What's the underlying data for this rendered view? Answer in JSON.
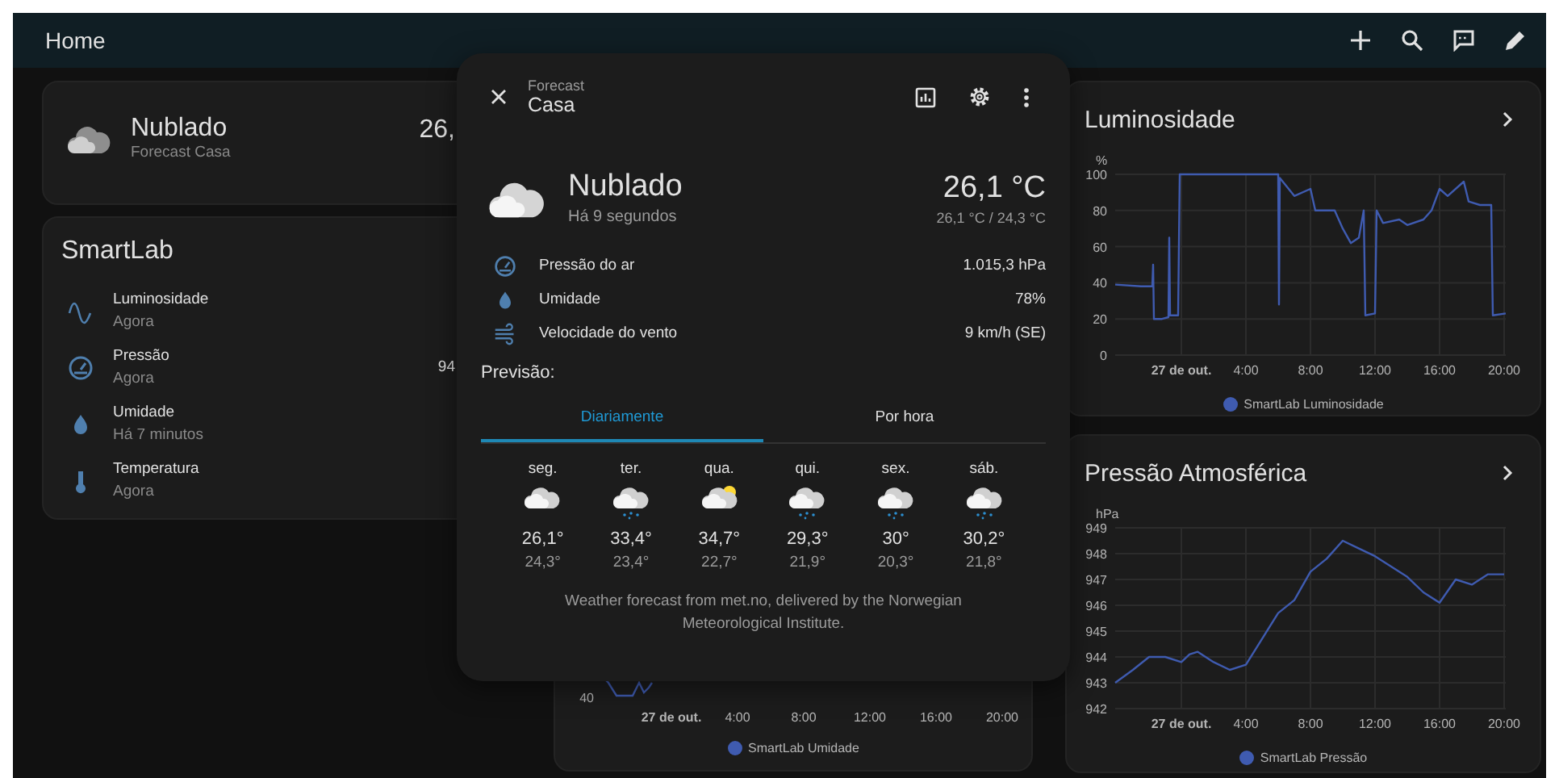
{
  "header": {
    "title": "Home"
  },
  "weather_card": {
    "condition": "Nublado",
    "name": "Forecast Casa",
    "temperature": "26,"
  },
  "smartlab": {
    "title": "SmartLab",
    "entities": [
      {
        "kind": "wave",
        "name": "Luminosidade",
        "time": "Agora"
      },
      {
        "kind": "gauge",
        "name": "Pressão",
        "time": "Agora",
        "value": "94"
      },
      {
        "kind": "drop",
        "name": "Umidade",
        "time": "Há 7 minutos"
      },
      {
        "kind": "thermometer",
        "name": "Temperatura",
        "time": "Agora"
      }
    ]
  },
  "humidity_card": {
    "ytick": "40",
    "xlabels": [
      "27 de out.",
      "4:00",
      "8:00",
      "12:00",
      "16:00",
      "20:00"
    ],
    "legend": "SmartLab Umidade"
  },
  "luminosity_card": {
    "title": "Luminosidade",
    "date_label": "27 de out.",
    "chart_data": {
      "type": "line",
      "grid": true,
      "ylabel": "%",
      "xlim": [
        -4.1,
        20.1
      ],
      "ylim": [
        0,
        100
      ],
      "yticks": [
        0,
        20,
        40,
        60,
        80,
        100
      ],
      "xticks": [
        {
          "value": 4,
          "label": "4:00"
        },
        {
          "value": 8,
          "label": "8:00"
        },
        {
          "value": 12,
          "label": "12:00"
        },
        {
          "value": 16,
          "label": "16:00"
        },
        {
          "value": 20,
          "label": "20:00"
        }
      ],
      "x": [
        -4.1,
        -2.5,
        -1.8,
        -1.75,
        -1.7,
        -1.2,
        -0.8,
        -0.75,
        -0.7,
        -0.6,
        -0.2,
        -0.1,
        6,
        6.05,
        6.1,
        7,
        8,
        8.3,
        9,
        9.5,
        10,
        10.5,
        11,
        11.3,
        11.4,
        12,
        12.1,
        12.5,
        13.5,
        14,
        15,
        15.5,
        16,
        16.5,
        17.5,
        17.8,
        18.5,
        19.2,
        19.3,
        20.1
      ],
      "series": [
        {
          "name": "SmartLab Luminosidade",
          "color": "#3f5bb0",
          "values": [
            39,
            38,
            38,
            50,
            20,
            20,
            21,
            65,
            22,
            22,
            22,
            100,
            100,
            28,
            98,
            88,
            92,
            80,
            80,
            80,
            70,
            62,
            65,
            80,
            22,
            23,
            80,
            73,
            75,
            72,
            75,
            80,
            92,
            88,
            96,
            85,
            83,
            83,
            22,
            23
          ]
        }
      ]
    }
  },
  "pressure_card": {
    "title": "Pressão Atmosférica",
    "date_label": "27 de out.",
    "chart_data": {
      "type": "line",
      "grid": true,
      "ylabel": "hPa",
      "xlim": [
        -4.1,
        20.1
      ],
      "ylim": [
        942,
        949
      ],
      "yticks": [
        942,
        943,
        944,
        945,
        946,
        947,
        948,
        949
      ],
      "xticks": [
        {
          "value": 4,
          "label": "4:00"
        },
        {
          "value": 8,
          "label": "8:00"
        },
        {
          "value": 12,
          "label": "12:00"
        },
        {
          "value": 16,
          "label": "16:00"
        },
        {
          "value": 20,
          "label": "20:00"
        }
      ],
      "x": [
        -4.1,
        -3,
        -2,
        -1,
        0,
        0.5,
        1,
        2,
        3,
        4,
        5,
        6,
        7,
        8,
        9,
        10,
        11,
        12,
        13,
        14,
        15,
        16,
        17,
        18,
        19,
        20
      ],
      "series": [
        {
          "name": "SmartLab Pressão",
          "color": "#3f5bb0",
          "values": [
            943,
            943.5,
            944,
            944,
            943.8,
            944.1,
            944.2,
            943.8,
            943.5,
            943.7,
            944.7,
            945.7,
            946.2,
            947.3,
            947.8,
            948.5,
            948.2,
            947.9,
            947.5,
            947.1,
            946.5,
            946.1,
            947,
            946.8,
            947.2,
            947.2
          ]
        }
      ]
    }
  },
  "dialog": {
    "subtitle": "Forecast",
    "title": "Casa",
    "condition": "Nublado",
    "updated": "Há 9 segundos",
    "temperature": "26,1 °C",
    "range": "26,1 °C / 24,3 °C",
    "attributes": [
      {
        "kind": "gauge",
        "label": "Pressão do ar",
        "value": "1.015,3 hPa"
      },
      {
        "kind": "drop",
        "label": "Umidade",
        "value": "78%"
      },
      {
        "kind": "wind",
        "label": "Velocidade do vento",
        "value": "9 km/h (SE)"
      }
    ],
    "forecast_label": "Previsão:",
    "tabs": [
      {
        "label": "Diariamente",
        "selected": true
      },
      {
        "label": "Por hora",
        "selected": false
      }
    ],
    "days": [
      {
        "day": "seg.",
        "kind": "cloudy",
        "high": "26,1°",
        "low": "24,3°"
      },
      {
        "day": "ter.",
        "kind": "rainy",
        "high": "33,4°",
        "low": "23,4°"
      },
      {
        "day": "qua.",
        "kind": "partlycloudy",
        "high": "34,7°",
        "low": "22,7°"
      },
      {
        "day": "qui.",
        "kind": "rainy",
        "high": "29,3°",
        "low": "21,9°"
      },
      {
        "day": "sex.",
        "kind": "rainy",
        "high": "30°",
        "low": "20,3°"
      },
      {
        "day": "sáb.",
        "kind": "rainy",
        "high": "30,2°",
        "low": "21,8°"
      }
    ],
    "attribution": "Weather forecast from met.no, delivered by the Norwegian Meteorological Institute."
  }
}
